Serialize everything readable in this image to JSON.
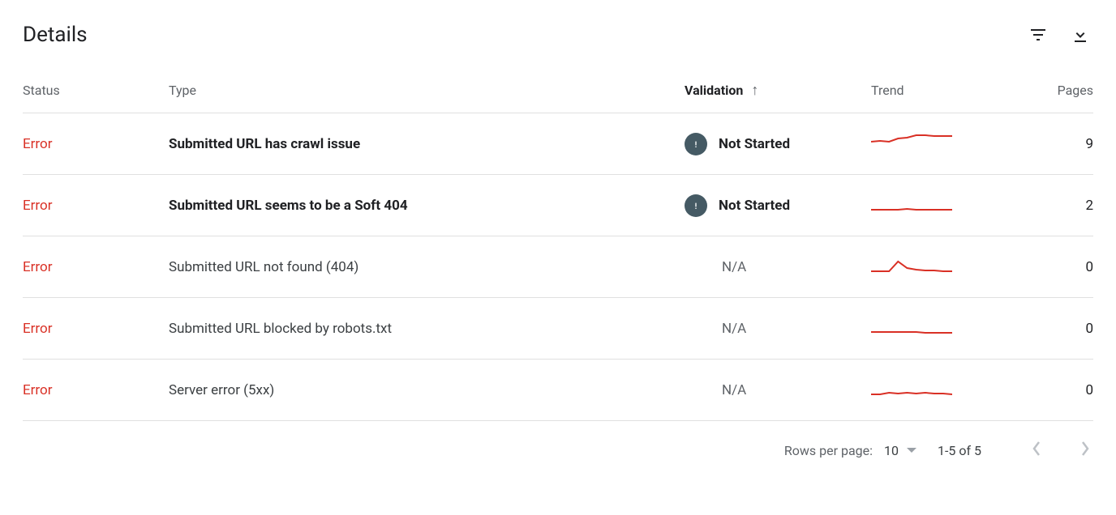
{
  "header": {
    "title": "Details"
  },
  "columns": {
    "status": "Status",
    "type": "Type",
    "validation": "Validation",
    "trend": "Trend",
    "pages": "Pages"
  },
  "rows": [
    {
      "status": "Error",
      "type": "Submitted URL has crawl issue",
      "bold": true,
      "validation": "Not Started",
      "badge": true,
      "trend": [
        12,
        11,
        12,
        8,
        7,
        4,
        4,
        5,
        5,
        5
      ],
      "pages": 9
    },
    {
      "status": "Error",
      "type": "Submitted URL seems to be a Soft 404",
      "bold": true,
      "validation": "Not Started",
      "badge": true,
      "trend": [
        20,
        20,
        20,
        20,
        19,
        20,
        20,
        20,
        20,
        20
      ],
      "pages": 2
    },
    {
      "status": "Error",
      "type": "Submitted URL not found (404)",
      "bold": false,
      "validation": "N/A",
      "badge": false,
      "trend": [
        20,
        20,
        20,
        8,
        16,
        18,
        19,
        19,
        20,
        20
      ],
      "pages": 0
    },
    {
      "status": "Error",
      "type": "Submitted URL blocked by robots.txt",
      "bold": false,
      "validation": "N/A",
      "badge": false,
      "trend": [
        19,
        19,
        19,
        19,
        19,
        19,
        20,
        20,
        20,
        20
      ],
      "pages": 0
    },
    {
      "status": "Error",
      "type": "Server error (5xx)",
      "bold": false,
      "validation": "N/A",
      "badge": false,
      "trend": [
        20,
        20,
        18,
        19,
        18,
        19,
        18,
        19,
        19,
        20
      ],
      "pages": 0
    }
  ],
  "footer": {
    "rows_per_page_label": "Rows per page:",
    "rows_per_page_value": "10",
    "range_label": "1-5 of 5"
  }
}
